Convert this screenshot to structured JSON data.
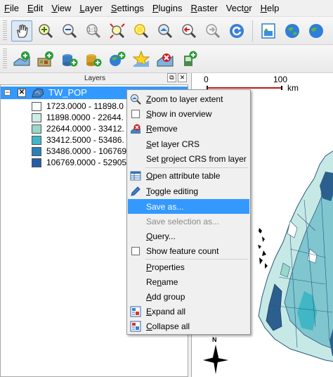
{
  "menubar": {
    "items": [
      {
        "pre": "",
        "key": "F",
        "post": "ile"
      },
      {
        "pre": "",
        "key": "E",
        "post": "dit"
      },
      {
        "pre": "",
        "key": "V",
        "post": "iew"
      },
      {
        "pre": "",
        "key": "L",
        "post": "ayer"
      },
      {
        "pre": "",
        "key": "S",
        "post": "ettings"
      },
      {
        "pre": "",
        "key": "P",
        "post": "lugins"
      },
      {
        "pre": "",
        "key": "R",
        "post": "aster"
      },
      {
        "pre": "Vect",
        "key": "o",
        "post": "r"
      },
      {
        "pre": "",
        "key": "H",
        "post": "elp"
      }
    ]
  },
  "toolbar1": {
    "icons": [
      "pan-hand-icon",
      "zoom-in-icon",
      "zoom-out-icon",
      "zoom-actual-icon",
      "zoom-full-icon",
      "zoom-selection-icon",
      "zoom-layer-icon",
      "zoom-last-icon",
      "zoom-next-icon",
      "refresh-icon",
      "new-map-view-icon",
      "map-tips-icon",
      "new-bookmark-icon"
    ]
  },
  "toolbar2": {
    "icons": [
      "add-vector-layer-icon",
      "add-raster-layer-icon",
      "add-postgis-layer-icon",
      "add-spatialite-layer-icon",
      "add-wms-layer-icon",
      "new-shapefile-layer-icon",
      "remove-layer-icon",
      "add-wfs-layer-icon"
    ]
  },
  "layers_panel": {
    "title": "Layers",
    "float_glyph": "⧉",
    "close_glyph": "✕",
    "expander_glyph": "−",
    "check_glyph": "✕",
    "layer": {
      "name": "TW_POP",
      "legend": [
        {
          "label": "1723.0000 - 11898.0",
          "color": "#f7fcfd"
        },
        {
          "label": "11898.0000 - 22644.",
          "color": "#ccece6"
        },
        {
          "label": "22644.0000 - 33412.",
          "color": "#99d8c9"
        },
        {
          "label": "33412.5000 - 53486.",
          "color": "#41b6c4"
        },
        {
          "label": "53486.0000 - 106769",
          "color": "#2c7fb8"
        },
        {
          "label": "106769.0000 - 52905",
          "color": "#225ea8"
        }
      ]
    }
  },
  "map": {
    "scale": {
      "zero": "0",
      "hundred": "100",
      "unit": "km"
    },
    "north_label": "N"
  },
  "context_menu": {
    "items": [
      {
        "pre": "",
        "key": "Z",
        "post": "oom to layer extent",
        "icon": "zoom-layer-icon"
      },
      {
        "pre": "",
        "key": "S",
        "post": "how in overview",
        "icon": "checkbox-icon"
      },
      {
        "pre": "",
        "key": "R",
        "post": "emove",
        "icon": "remove-layer-icon"
      },
      {
        "pre": "",
        "key": "S",
        "post": "et layer CRS",
        "icon": ""
      },
      {
        "pre": "Set ",
        "key": "p",
        "post": "roject CRS from layer",
        "icon": ""
      },
      {
        "pre": "",
        "key": "O",
        "post": "pen attribute table",
        "icon": "attribute-table-icon"
      },
      {
        "pre": "",
        "key": "T",
        "post": "oggle editing",
        "icon": "pencil-icon"
      },
      {
        "pre": "Save as...",
        "key": "",
        "post": "",
        "icon": "",
        "highlighted": true
      },
      {
        "pre": "Save selection as...",
        "key": "",
        "post": "",
        "icon": "",
        "disabled": true
      },
      {
        "pre": "",
        "key": "Q",
        "post": "uery...",
        "icon": ""
      },
      {
        "pre": "Show feature count",
        "key": "",
        "post": "",
        "icon": "checkbox-icon"
      },
      {
        "pre": "",
        "key": "P",
        "post": "roperties",
        "icon": ""
      },
      {
        "pre": "Re",
        "key": "n",
        "post": "ame",
        "icon": ""
      },
      {
        "pre": "",
        "key": "A",
        "post": "dd group",
        "icon": ""
      },
      {
        "pre": "",
        "key": "E",
        "post": "xpand all",
        "icon": "expand-all-icon"
      },
      {
        "pre": "",
        "key": "C",
        "post": "ollapse all",
        "icon": "collapse-all-icon"
      }
    ]
  },
  "colors": {
    "selection": "#3399ff",
    "map_fill_light": "#c7e9e5",
    "map_fill_dark": "#2c5f8e"
  }
}
